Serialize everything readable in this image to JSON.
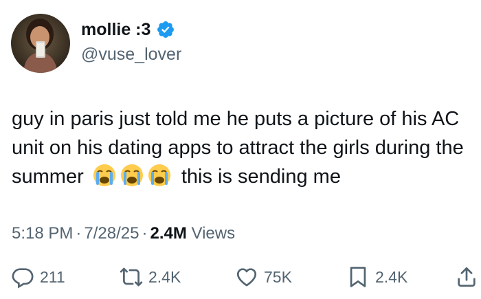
{
  "author": {
    "display_name": "mollie :3",
    "handle": "@vuse_lover",
    "verified": true
  },
  "tweet": {
    "text_before": "guy in paris just told me he puts a picture of his AC unit on his dating apps to attract the girls during the summer",
    "emojis": [
      "loudly-crying-face",
      "loudly-crying-face",
      "loudly-crying-face"
    ],
    "text_after": "this is sending me"
  },
  "meta": {
    "time": "5:18 PM",
    "separator": "·",
    "date": "7/28/25",
    "views_count": "2.4M",
    "views_label": "Views"
  },
  "actions": {
    "replies": "211",
    "reposts": "2.4K",
    "likes": "75K",
    "bookmarks": "2.4K"
  },
  "colors": {
    "text_primary": "#0f1419",
    "text_secondary": "#536471",
    "verified_blue": "#1d9bf0"
  }
}
